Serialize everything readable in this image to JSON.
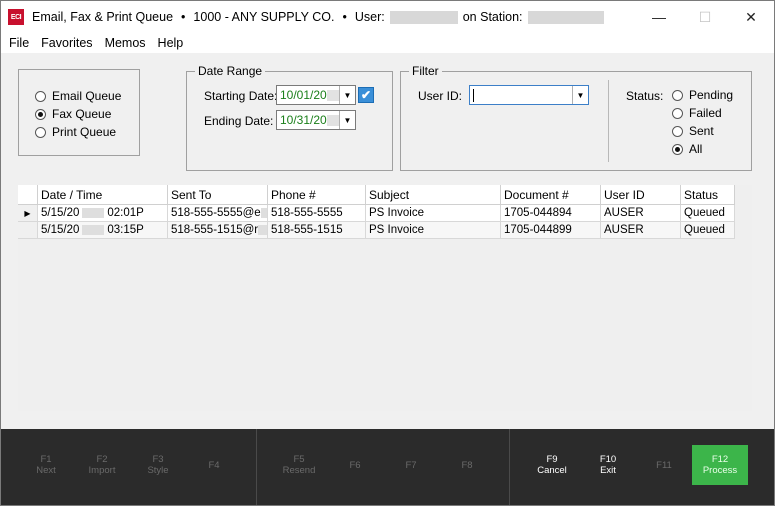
{
  "window": {
    "logo_text": "ECI",
    "title_app": "Email, Fax & Print Queue",
    "title_company": "1000 - ANY SUPPLY CO.",
    "title_user_label": "User:",
    "title_station_label": "on Station:",
    "bullet": "•",
    "minimize_icon": "—",
    "maximize_icon": "☐",
    "close_icon": "✕"
  },
  "menu": [
    "File",
    "Favorites",
    "Memos",
    "Help"
  ],
  "queue_type": {
    "options": [
      "Email Queue",
      "Fax Queue",
      "Print Queue"
    ],
    "selected": "Fax Queue"
  },
  "date_range": {
    "legend": "Date Range",
    "start_label": "Starting Date:",
    "start_value": "10/01/20",
    "end_label": "Ending Date:",
    "end_value": "10/31/20",
    "start_enabled": true,
    "check_glyph": "✔",
    "dropdown_glyph": "▼"
  },
  "filter": {
    "legend": "Filter",
    "user_label": "User ID:",
    "user_value": "",
    "status_label": "Status:",
    "status_options": [
      "Pending",
      "Failed",
      "Sent",
      "All"
    ],
    "status_selected": "All"
  },
  "grid": {
    "row_pointer": "▶",
    "columns": [
      "Date / Time",
      "Sent To",
      "Phone #",
      "Subject",
      "Document #",
      "User ID",
      "Status"
    ],
    "rows": [
      {
        "date": "5/15/20",
        "time": "02:01P",
        "sent_to": "518-555-5555@e",
        "phone": "518-555-5555",
        "subject": "PS Invoice",
        "document": "1705-044894",
        "user": "AUSER",
        "status": "Queued"
      },
      {
        "date": "5/15/20",
        "time": "03:15P",
        "sent_to": "518-555-1515@r",
        "phone": "518-555-1515",
        "subject": "PS Invoice",
        "document": "1705-044899",
        "user": "AUSER",
        "status": "Queued"
      }
    ]
  },
  "fkeys": [
    {
      "key": "F1",
      "label": "Next",
      "enabled": false
    },
    {
      "key": "F2",
      "label": "Import",
      "enabled": false
    },
    {
      "key": "F3",
      "label": "Style",
      "enabled": false
    },
    {
      "key": "F4",
      "label": "",
      "enabled": false
    },
    {
      "key": "F5",
      "label": "Resend",
      "enabled": false
    },
    {
      "key": "F6",
      "label": "",
      "enabled": false
    },
    {
      "key": "F7",
      "label": "",
      "enabled": false
    },
    {
      "key": "F8",
      "label": "",
      "enabled": false
    },
    {
      "key": "F9",
      "label": "Cancel",
      "enabled": true
    },
    {
      "key": "F10",
      "label": "Exit",
      "enabled": true
    },
    {
      "key": "F11",
      "label": "",
      "enabled": false
    },
    {
      "key": "F12",
      "label": "Process",
      "enabled": true
    }
  ],
  "colors": {
    "accent_green": "#3cb54a",
    "date_text": "#1a7f1a",
    "fkey_bar": "#2b2b2b"
  }
}
